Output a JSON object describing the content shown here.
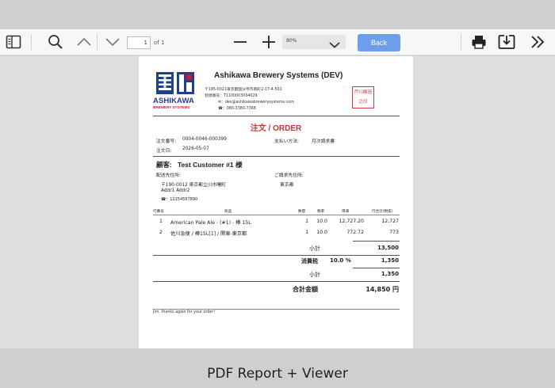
{
  "toolbar": {
    "page_number": "1",
    "page_of": "of 1",
    "zoom": "80%",
    "back_label": "Back",
    "icons": [
      "sidebar-icon",
      "search-icon",
      "chevron-up-icon",
      "chevron-down-icon",
      "zoom-out-icon",
      "zoom-in-icon",
      "print-icon",
      "download-icon",
      "more-icon"
    ]
  },
  "document": {
    "company_name": "Ashikawa Brewery Systems (DEV)",
    "address_line": "〒185-0021東京都国分寺市南町2-17-4-502",
    "reg_line": "登録番号：T1100003004029",
    "email_line": "✉：dev@ashikawabrewerysystems.com",
    "phone_line": "☎：080-3380-7368",
    "logo_text": "ASHIKAWA",
    "logo_sub": "BREWERY SYSTEMS",
    "title": "注文 / ORDER",
    "order_no_label": "注文番号:",
    "order_no": "0004-0046-000399",
    "order_date_label": "注文日:",
    "order_date": "2026-05-07",
    "payment_label": "支払い方法:",
    "payment": "月次請求書",
    "customer_label": "顧客:",
    "customer_name": "Test Customer #1 様",
    "ship_label": "配送先住所:",
    "ship_addr1": "〒190-0012 東京都立川市曙町",
    "ship_addr2": "Addr1 Addr2",
    "ship_phone": "☎：12154567890",
    "bill_label": "ご請求先住所:",
    "bill_addr": "東京都",
    "table_headers": [
      "行番号",
      "商品",
      "数量",
      "税率",
      "単価",
      "行合計(税抜)"
    ],
    "lines": [
      {
        "no": "1",
        "item": "American Pale Ale - (#1) - 樽 15L",
        "qty": "1",
        "tax": "10.0",
        "price": "12,727.20",
        "total": "12,727"
      },
      {
        "no": "2",
        "item": "佐川急便 / 樽15L[1] / 関東-東京都",
        "qty": "1",
        "tax": "10.0",
        "price": "772.72",
        "total": "773"
      }
    ],
    "subtotal_label": "小計",
    "subtotal": "13,500",
    "tax_label": "消費税",
    "tax_rate": "10.0 %",
    "tax_amount": "1,350",
    "tax_subtotal_label": "小計",
    "tax_subtotal": "1,350",
    "grand_label": "合計金額",
    "grand_total": "14,850 円",
    "footer_note": "Jim, thanks again for your order!"
  },
  "caption": "PDF Report + Viewer"
}
